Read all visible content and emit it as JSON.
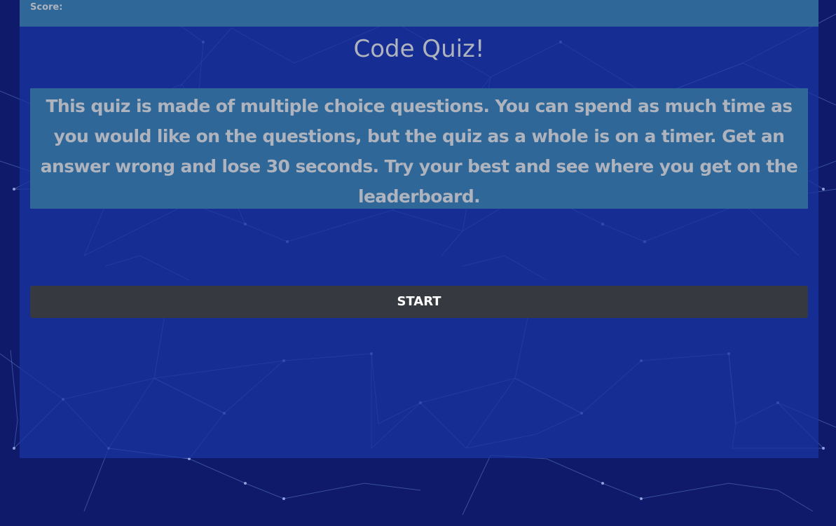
{
  "score": {
    "label": "Score:"
  },
  "header": {
    "title": "Code Quiz!"
  },
  "intro": {
    "text": "This quiz is made of multiple choice questions. You can spend as much time as you would like on the questions, but the quiz as a whole is on a timer. Get an answer wrong and lose 30 seconds. Try your best and see where you get on the leaderboard."
  },
  "actions": {
    "start_label": "START"
  },
  "colors": {
    "page_background": "#0f1a6b",
    "panel": "#1834a0",
    "bar": "#2f6898",
    "text_muted": "#aeb3bd",
    "button": "#363a40",
    "button_text": "#ffffff"
  }
}
